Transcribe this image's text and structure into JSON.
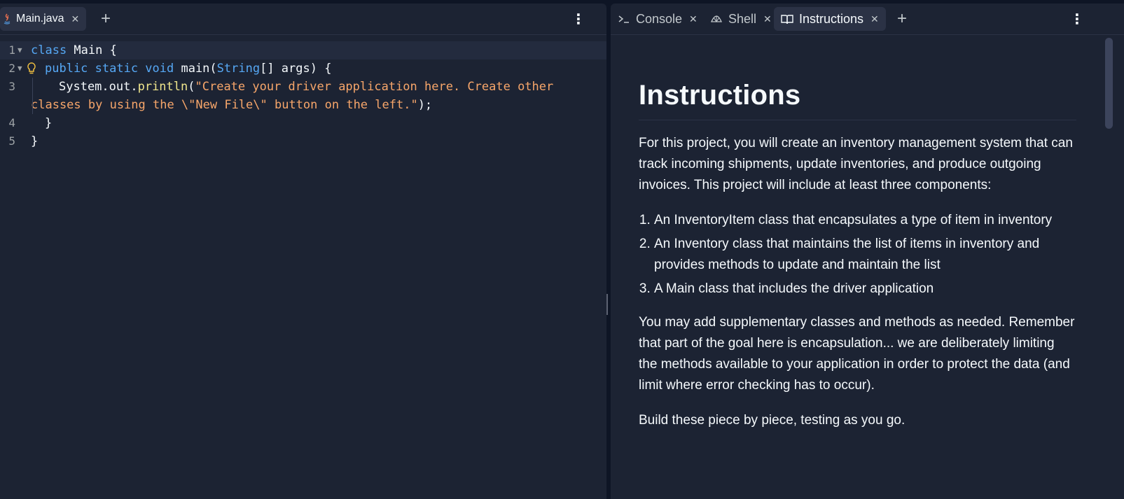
{
  "editor": {
    "tab": {
      "label": "Main.java",
      "icon": "java-icon"
    },
    "lines": [
      {
        "num": "1"
      },
      {
        "num": "2"
      },
      {
        "num": "3"
      },
      {
        "num": "4"
      },
      {
        "num": "5"
      }
    ],
    "code": {
      "l1_kw": "class",
      "l1_rest": " Main {",
      "l2_kw": "public static void",
      "l2_fn": " main(",
      "l2_type": "String",
      "l2_rest": "[] args) {",
      "l3_obj": "System.out.",
      "l3_fn": "println",
      "l3_open": "(",
      "l3_str": "\"Create your driver application here. Create other",
      "l3b_str": "classes by using the \\\"New File\\\" button on the left.\"",
      "l3b_rest": ");",
      "l4": "}",
      "l5": "}"
    }
  },
  "right": {
    "tabs": [
      {
        "label": "Console",
        "icon": "terminal-icon"
      },
      {
        "label": "Shell",
        "icon": "shell-icon"
      },
      {
        "label": "Instructions",
        "icon": "book-icon"
      }
    ],
    "doc": {
      "title": "Instructions",
      "p1": "For this project, you will create an inventory management system that can track incoming shipments, update inventories, and produce outgoing invoices. This project will include at least three components:",
      "items": [
        "An InventoryItem class that encapsulates a type of item in inventory",
        "An Inventory class that maintains the list of items in inventory and provides methods to update and maintain the list",
        "A Main class that includes the driver application"
      ],
      "p2": "You may add supplementary classes and methods as needed. Remember that part of the goal here is encapsulation... we are deliberately limiting the methods available to your application in order to protect the data (and limit where error checking has to occur).",
      "p3": "Build these piece by piece, testing as you go."
    }
  },
  "colors": {
    "background": "#0e1525",
    "panel": "#1c2333",
    "keyword": "#56a8f5",
    "string": "#f7a66a",
    "function": "#f0e68c"
  }
}
